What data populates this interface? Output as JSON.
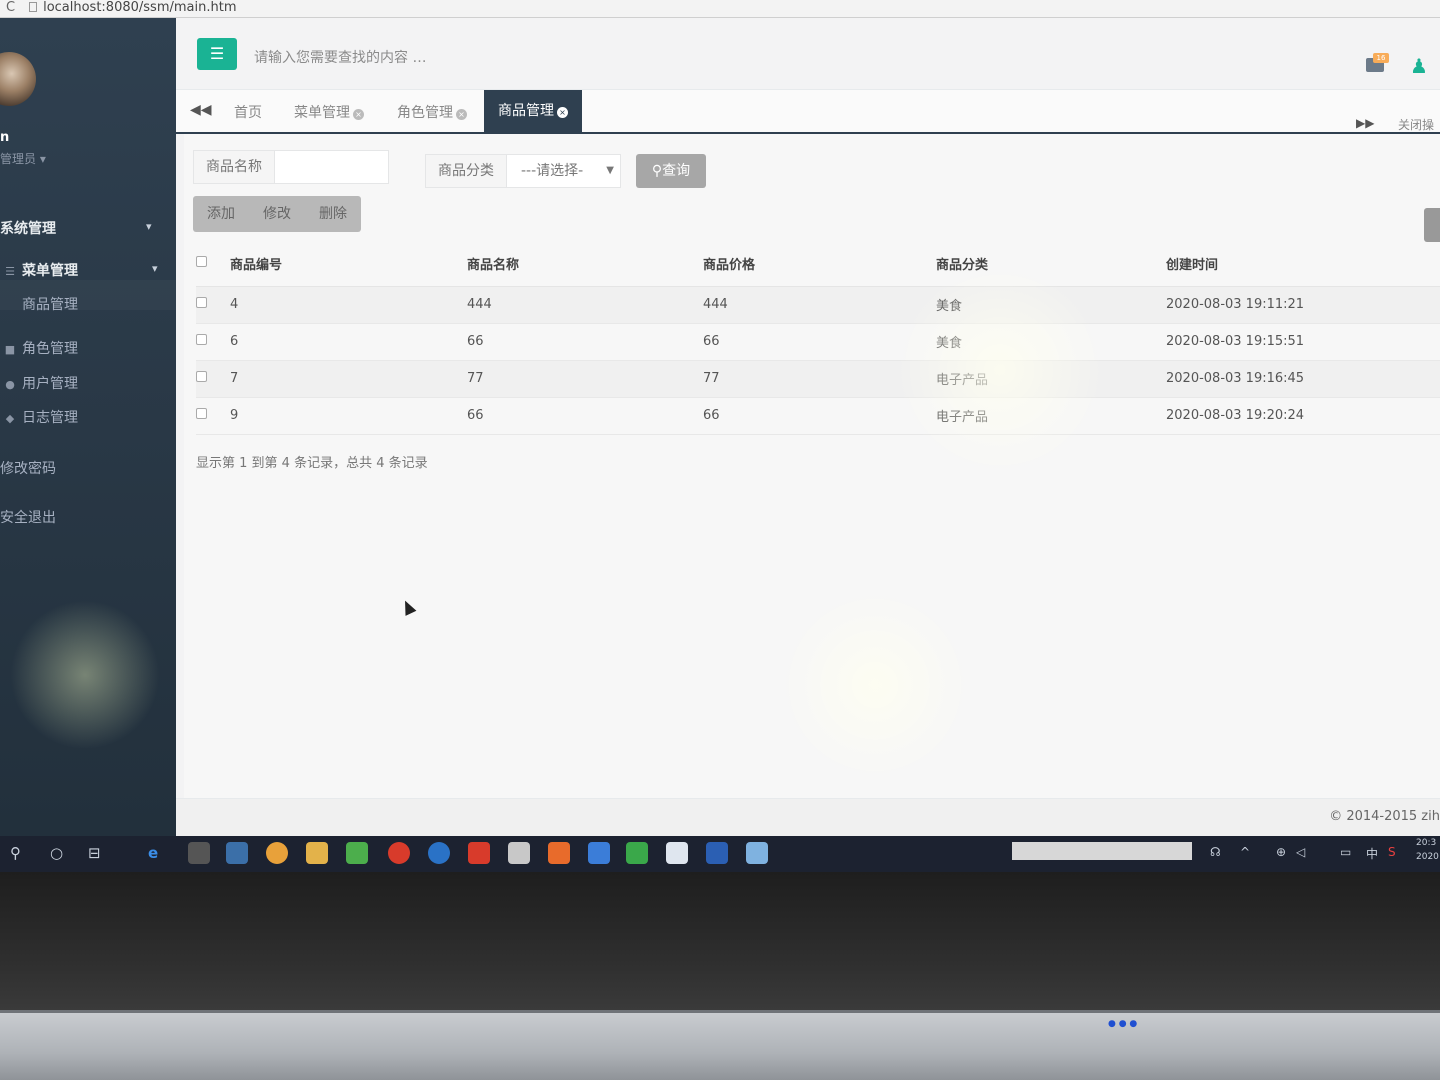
{
  "browser": {
    "url": "localhost:8080/ssm/main.htm"
  },
  "sidebar": {
    "user_name": "n",
    "user_role": "管理员 ▾",
    "items": [
      {
        "label": "系统管理",
        "icon": "",
        "chevron": "⌄"
      },
      {
        "label": "菜单管理",
        "icon": "sliders-icon",
        "chevron": "⌄"
      },
      {
        "label": "商品管理",
        "icon": ""
      },
      {
        "label": "角色管理",
        "icon": "group-icon"
      },
      {
        "label": "用户管理",
        "icon": "user-icon"
      },
      {
        "label": "日志管理",
        "icon": "tag-icon"
      },
      {
        "label": "修改密码",
        "icon": ""
      },
      {
        "label": "安全退出",
        "icon": ""
      }
    ]
  },
  "topbar": {
    "search_placeholder": "请输入您需要查找的内容 …",
    "mail_badge": "16"
  },
  "tabs": {
    "items": [
      {
        "label": "首页"
      },
      {
        "label": "菜单管理"
      },
      {
        "label": "角色管理"
      },
      {
        "label": "商品管理"
      }
    ],
    "active_index": 3,
    "close_label": "关闭操"
  },
  "filters": {
    "name_label": "商品名称",
    "name_value": "",
    "category_label": "商品分类",
    "category_value": "---请选择-",
    "query_button": "查询"
  },
  "toolbar": {
    "add": "添加",
    "edit": "修改",
    "delete": "删除"
  },
  "table": {
    "columns": [
      "商品编号",
      "商品名称",
      "商品价格",
      "商品分类",
      "创建时间"
    ],
    "rows": [
      [
        "4",
        "444",
        "444",
        "美食",
        "2020-08-03 19:11:21"
      ],
      [
        "6",
        "66",
        "66",
        "美食",
        "2020-08-03 19:15:51"
      ],
      [
        "7",
        "77",
        "77",
        "电子产品",
        "2020-08-03 19:16:45"
      ],
      [
        "9",
        "66",
        "66",
        "电子产品",
        "2020-08-03 19:20:24"
      ]
    ]
  },
  "pager": {
    "summary": "显示第 1 到第 4 条记录，总共 4 条记录"
  },
  "footer": {
    "copyright": "© 2014-2015 zih"
  },
  "taskbar": {
    "ime": "中",
    "clock_time": "20:3",
    "clock_date": "2020"
  },
  "colors": {
    "sidebar_bg": "#2f4050",
    "accent_green": "#1ab394",
    "active_tab": "#2f4050"
  }
}
